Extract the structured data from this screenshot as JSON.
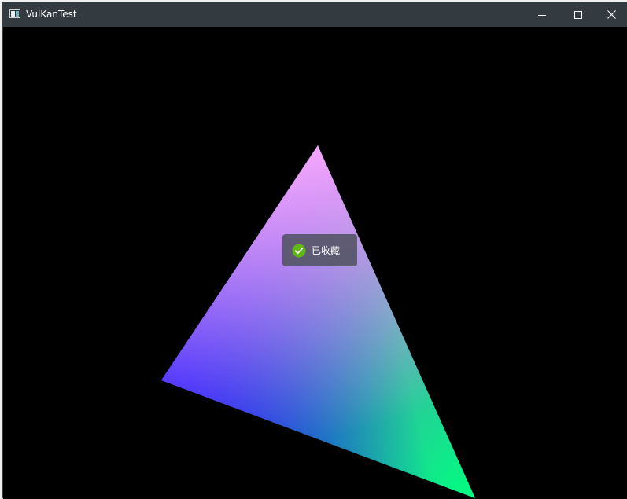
{
  "window": {
    "title": "VulKanTest",
    "icon": "app-window-icon",
    "controls": {
      "minimize_icon": "minimize-icon",
      "maximize_icon": "maximize-icon",
      "close_icon": "close-icon"
    }
  },
  "viewport": {
    "background_color": "#000000",
    "triangle": {
      "vertex_colors": {
        "top": "#f6a6ff",
        "bottom_left": "#0000ff",
        "bottom_right": "#00ff80"
      }
    }
  },
  "toast": {
    "icon": "check-circle-icon",
    "icon_color": "#5fb818",
    "message": "已收藏"
  },
  "colors": {
    "titlebar_bg": "#333b40",
    "titlebar_text": "#ffffff",
    "toast_bg": "#565668"
  }
}
